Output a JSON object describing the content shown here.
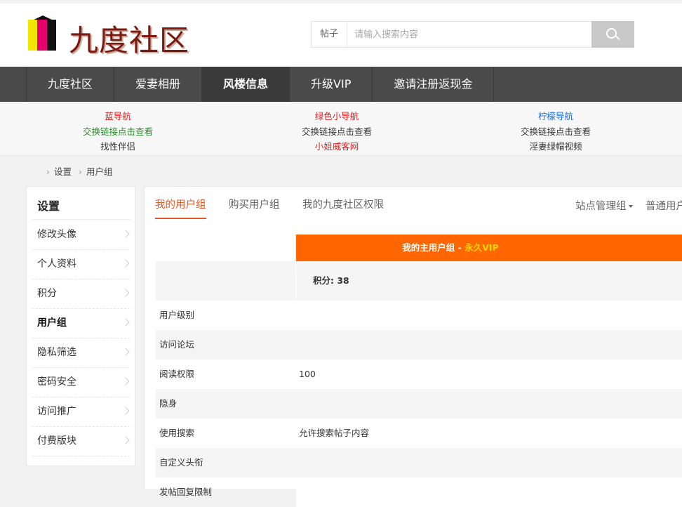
{
  "header": {
    "logo_text": "九度社区",
    "search": {
      "type_label": "帖子",
      "placeholder": "请输入搜索内容"
    }
  },
  "nav": {
    "items": [
      "九度社区",
      "爱妻相册",
      "风楼信息",
      "升级VIP",
      "邀请注册返现金"
    ]
  },
  "links": {
    "col1": [
      "蓝导航",
      "交换链接点击查看",
      "找性伴侣"
    ],
    "col2": [
      "绿色小导航",
      "交换链接点击查看",
      "小姐威客网"
    ],
    "col3": [
      "柠檬导航",
      "交换链接点击查看",
      "淫妻绿帽视频"
    ]
  },
  "breadcrumb": [
    "设置",
    "用户组"
  ],
  "sidebar": {
    "title": "设置",
    "items": [
      "修改头像",
      "个人资料",
      "积分",
      "用户组",
      "隐私筛选",
      "密码安全",
      "访问推广",
      "付费版块"
    ]
  },
  "tabs": {
    "items": [
      "我的用户组",
      "购买用户组",
      "我的九度社区权限"
    ],
    "right": [
      "站点管理组",
      "普通用户"
    ]
  },
  "group": {
    "header_prefix": "我的主用户组 - ",
    "header_vip": "永久VIP",
    "points": "积分: 38"
  },
  "table": {
    "rows": [
      {
        "label": "用户级别",
        "value": ""
      },
      {
        "label": "访问论坛",
        "value": ""
      },
      {
        "label": "阅读权限",
        "value": "100"
      },
      {
        "label": "隐身",
        "value": ""
      },
      {
        "label": "使用搜索",
        "value": "允许搜索帖子内容"
      },
      {
        "label": "自定义头衔",
        "value": ""
      },
      {
        "label": "发帖回复限制",
        "value": ""
      }
    ]
  },
  "colors": {
    "nav_bg": "#4a4a4a",
    "accent_orange": "#ff6600",
    "tab_active": "#e25a2c",
    "vip_yellow": "#ffd500"
  }
}
